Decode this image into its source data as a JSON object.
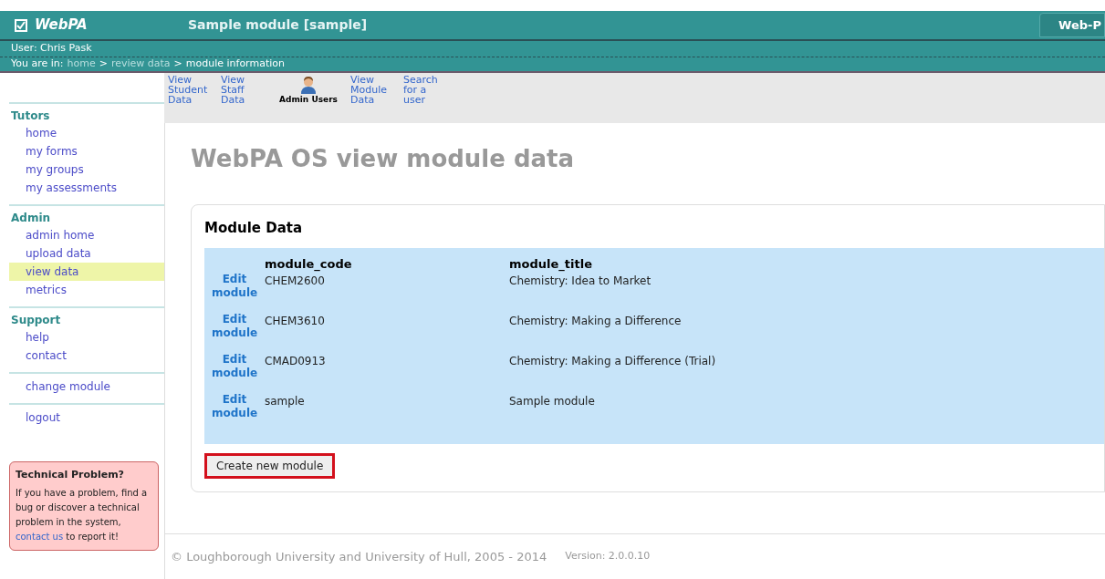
{
  "header": {
    "logo": "WebPA",
    "module_title": "Sample module [sample]",
    "tab": "Web-P"
  },
  "user_bar": {
    "user": "User: Chris Pask"
  },
  "breadcrumb": {
    "prefix": "You are in:",
    "links": [
      "home",
      "review data"
    ],
    "current": "module information",
    "separator": ">"
  },
  "toolbar": [
    {
      "kind": "link",
      "label": "View Student Data"
    },
    {
      "kind": "link",
      "label": "View Staff Data"
    },
    {
      "kind": "icon",
      "label": "Admin Users"
    },
    {
      "kind": "link",
      "label": "View Module Data"
    },
    {
      "kind": "link",
      "label": "Search for a user"
    }
  ],
  "sidebar": [
    {
      "title": "Tutors",
      "items": [
        {
          "label": "home",
          "selected": false
        },
        {
          "label": "my forms",
          "selected": false
        },
        {
          "label": "my groups",
          "selected": false
        },
        {
          "label": "my assessments",
          "selected": false
        }
      ]
    },
    {
      "title": "Admin",
      "items": [
        {
          "label": "admin home",
          "selected": false
        },
        {
          "label": "upload data",
          "selected": false
        },
        {
          "label": "view data",
          "selected": true
        },
        {
          "label": "metrics",
          "selected": false
        }
      ]
    },
    {
      "title": "Support",
      "items": [
        {
          "label": "help",
          "selected": false
        },
        {
          "label": "contact",
          "selected": false
        }
      ]
    },
    {
      "items": [
        {
          "label": "change module",
          "selected": false
        }
      ]
    },
    {
      "items": [
        {
          "label": "logout",
          "selected": false
        }
      ]
    }
  ],
  "problem_box": {
    "title": "Technical Problem?",
    "text_before": "If you have a problem, find a bug or discover a technical problem in the system,",
    "link": "contact us",
    "text_after": "to report it!"
  },
  "page_title": "WebPA OS view module data",
  "panel": {
    "title": "Module Data",
    "columns": [
      "module_code",
      "module_title"
    ],
    "rows": [
      {
        "action": "Edit module",
        "code": "CHEM2600",
        "title": "Chemistry: Idea to Market"
      },
      {
        "action": "Edit module",
        "code": "CHEM3610",
        "title": "Chemistry: Making a Difference"
      },
      {
        "action": "Edit module",
        "code": "CMAD0913",
        "title": "Chemistry: Making a Difference (Trial)"
      },
      {
        "action": "Edit module",
        "code": "sample",
        "title": "Sample module"
      }
    ],
    "button": "Create new module"
  },
  "footer": {
    "copyright": "© Loughborough University and University of Hull, 2005 - 2014",
    "version": "Version: 2.0.0.10"
  }
}
